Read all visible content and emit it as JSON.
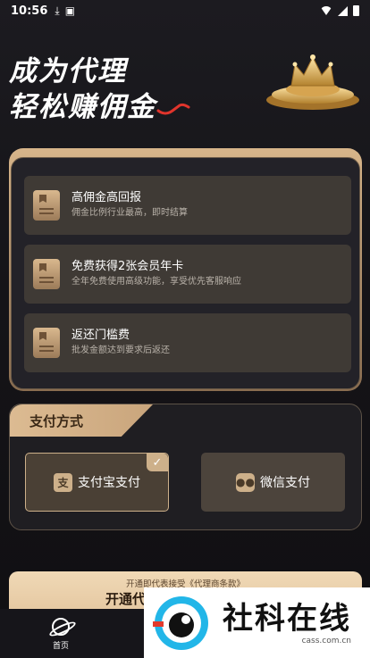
{
  "status_bar": {
    "time": "10:56",
    "icons": [
      "download-icon",
      "a-icon",
      "wifi-icon",
      "signal-icon",
      "battery-icon"
    ]
  },
  "hero": {
    "line1": "成为代理",
    "line2": "轻松赚佣金"
  },
  "benefits": [
    {
      "title": "高佣金高回报",
      "desc": "佣金比例行业最高，即时结算",
      "icon": "bookmark-icon"
    },
    {
      "title": "免费获得2张会员年卡",
      "desc": "全年免费使用高级功能，享受优先客服响应",
      "icon": "bookmark-icon"
    },
    {
      "title": "返还门槛费",
      "desc": "批发金额达到要求后返还",
      "icon": "bookmark-icon"
    }
  ],
  "payment": {
    "header": "支付方式",
    "alipay_label": "支付宝支付",
    "alipay_icon_char": "支",
    "wechat_label": "微信支付",
    "selected": "alipay"
  },
  "cta": {
    "agreement": "开通即代表接受《代理商条款》",
    "button_label": "开通代"
  },
  "tabbar": {
    "home_label": "首页"
  },
  "watermark": {
    "title": "社科在线",
    "url": "cass.com.cn"
  },
  "colors": {
    "gold": "#d7b58a",
    "card": "#3f3a35",
    "background": "#151418"
  }
}
